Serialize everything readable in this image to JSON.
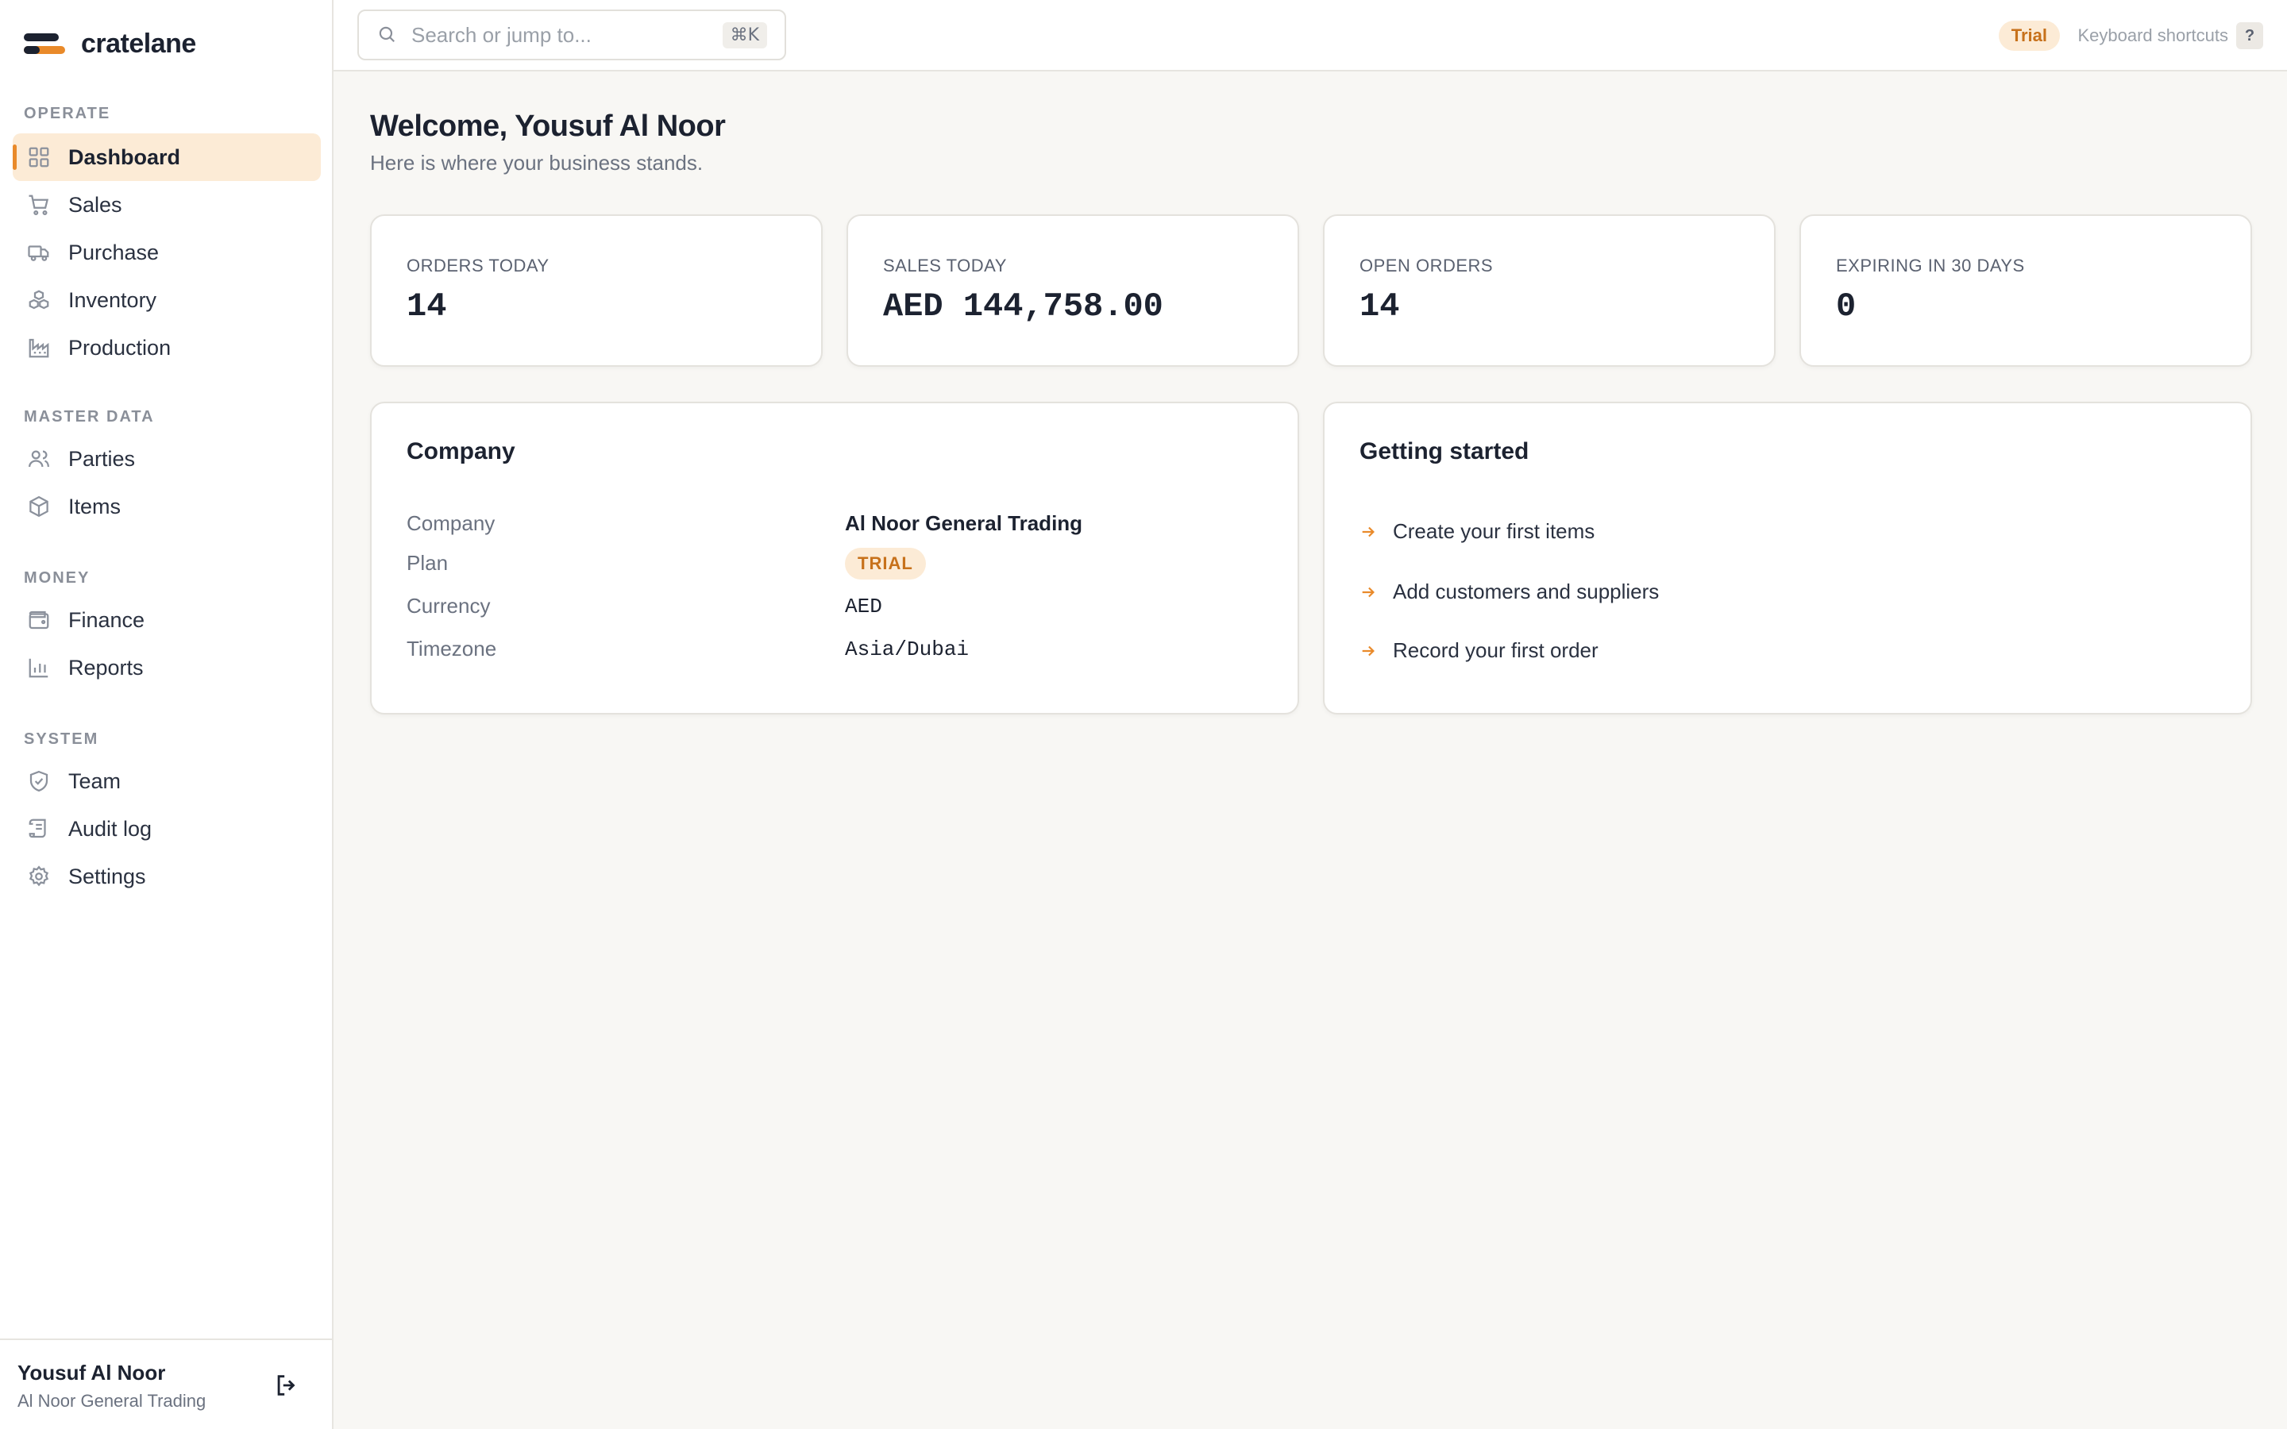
{
  "brand": {
    "name": "cratelane"
  },
  "sidebar": {
    "sections": [
      {
        "title": "OPERATE",
        "items": [
          {
            "label": "Dashboard",
            "icon": "grid-icon",
            "active": true
          },
          {
            "label": "Sales",
            "icon": "cart-icon"
          },
          {
            "label": "Purchase",
            "icon": "truck-icon"
          },
          {
            "label": "Inventory",
            "icon": "boxes-icon"
          },
          {
            "label": "Production",
            "icon": "factory-icon"
          }
        ]
      },
      {
        "title": "MASTER DATA",
        "items": [
          {
            "label": "Parties",
            "icon": "users-icon"
          },
          {
            "label": "Items",
            "icon": "package-icon"
          }
        ]
      },
      {
        "title": "MONEY",
        "items": [
          {
            "label": "Finance",
            "icon": "wallet-icon"
          },
          {
            "label": "Reports",
            "icon": "bar-chart-icon"
          }
        ]
      },
      {
        "title": "SYSTEM",
        "items": [
          {
            "label": "Team",
            "icon": "shield-check-icon"
          },
          {
            "label": "Audit log",
            "icon": "scroll-icon"
          },
          {
            "label": "Settings",
            "icon": "gear-icon"
          }
        ]
      }
    ],
    "user": {
      "name": "Yousuf Al Noor",
      "company": "Al Noor General Trading"
    }
  },
  "topbar": {
    "search_placeholder": "Search or jump to...",
    "search_shortcut": "⌘K",
    "trial_label": "Trial",
    "shortcuts_label": "Keyboard shortcuts",
    "shortcuts_key": "?"
  },
  "main": {
    "welcome": "Welcome, Yousuf Al Noor",
    "subtitle": "Here is where your business stands.",
    "stats": [
      {
        "label": "ORDERS TODAY",
        "value": "14"
      },
      {
        "label": "SALES TODAY",
        "value": "AED 144,758.00"
      },
      {
        "label": "OPEN ORDERS",
        "value": "14"
      },
      {
        "label": "EXPIRING IN 30 DAYS",
        "value": "0"
      }
    ],
    "company_panel": {
      "title": "Company",
      "rows": [
        {
          "key": "Company",
          "value": "Al Noor General Trading"
        },
        {
          "key": "Plan",
          "value": "TRIAL"
        },
        {
          "key": "Currency",
          "value": "AED"
        },
        {
          "key": "Timezone",
          "value": "Asia/Dubai"
        }
      ]
    },
    "getting_started": {
      "title": "Getting started",
      "items": [
        "Create your first items",
        "Add customers and suppliers",
        "Record your first order"
      ]
    }
  },
  "colors": {
    "accent": "#e98a2a",
    "accent_soft": "#fcebd6",
    "background": "#f8f7f4"
  }
}
